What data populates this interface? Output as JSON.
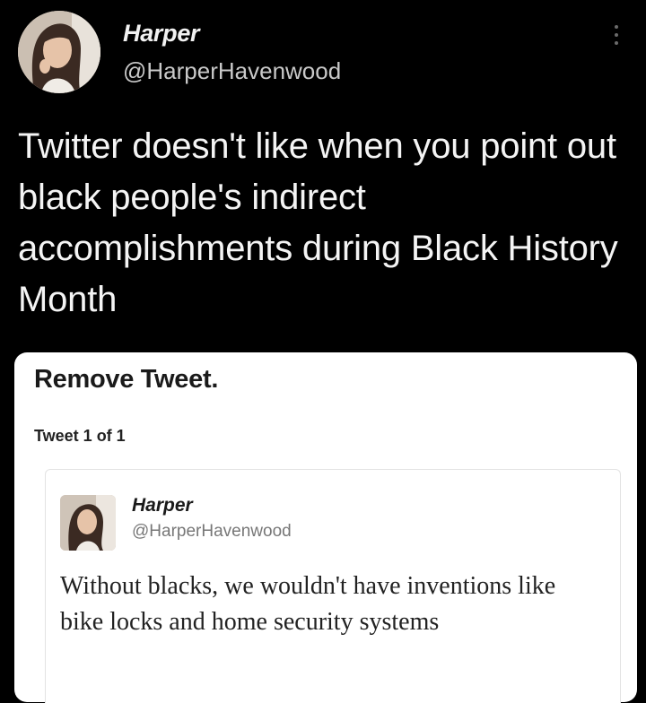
{
  "tweet": {
    "display_name": "Harper",
    "handle": "@HarperHavenwood",
    "text": "Twitter doesn't like when you point out black people's indirect accomplishments during Black History Month",
    "more_icon": "more-vertical-icon"
  },
  "notice": {
    "title": "Remove Tweet.",
    "subtitle": "Tweet 1 of 1"
  },
  "quoted_tweet": {
    "display_name": "Harper",
    "handle": "@HarperHavenwood",
    "text": "Without blacks, we wouldn't have inventions like bike locks and home security systems"
  }
}
